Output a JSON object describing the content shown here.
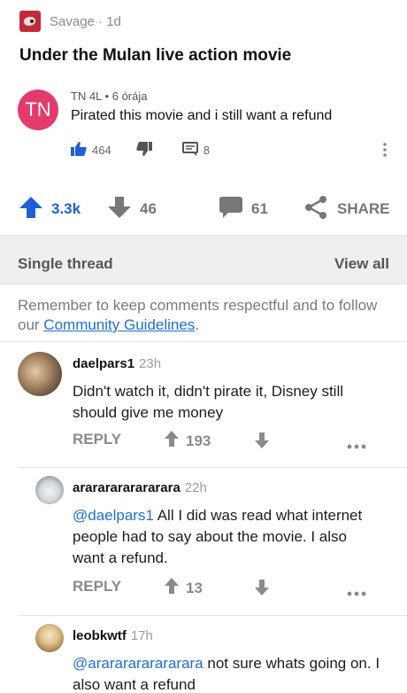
{
  "post": {
    "subreddit": "Savage",
    "age": "1d",
    "separator": "·",
    "title": "Under the Mulan live action movie"
  },
  "screenshot_comment": {
    "avatar_initials": "TN",
    "author": "TN 4L",
    "time": "6 órája",
    "meta_separator": "•",
    "text": "Pirated this movie and i still want a refund",
    "likes": "464",
    "replies": "8"
  },
  "vote_bar": {
    "upvotes": "3.3k",
    "downvotes": "46",
    "comments": "61",
    "share_label": "SHARE"
  },
  "thread_bar": {
    "left_label": "Single thread",
    "right_label": "View all"
  },
  "guidelines": {
    "text_before": "Remember to keep comments respectful and to follow our ",
    "link": "Community Guidelines",
    "text_after": "."
  },
  "comments": [
    {
      "author": "daelpars1",
      "age": "23h",
      "mention": "",
      "text": "Didn't watch it, didn't pirate it, Disney still should give me money",
      "reply_label": "REPLY",
      "score": "193"
    },
    {
      "author": "arararararararara",
      "age": "22h",
      "mention": "@daelpars1",
      "text": " All I did was read what internet people had to say about the movie. I also want a refund.",
      "reply_label": "REPLY",
      "score": "13"
    },
    {
      "author": "leobkwtf",
      "age": "17h",
      "mention": "@arararararararara",
      "text": " not sure whats going on. I also want a refund"
    }
  ],
  "colors": {
    "upvote_blue": "#1e5fd6",
    "link_blue": "#1e6ed6",
    "yt_avatar": "#e53a6c",
    "subreddit_icon": "#c22a38"
  }
}
